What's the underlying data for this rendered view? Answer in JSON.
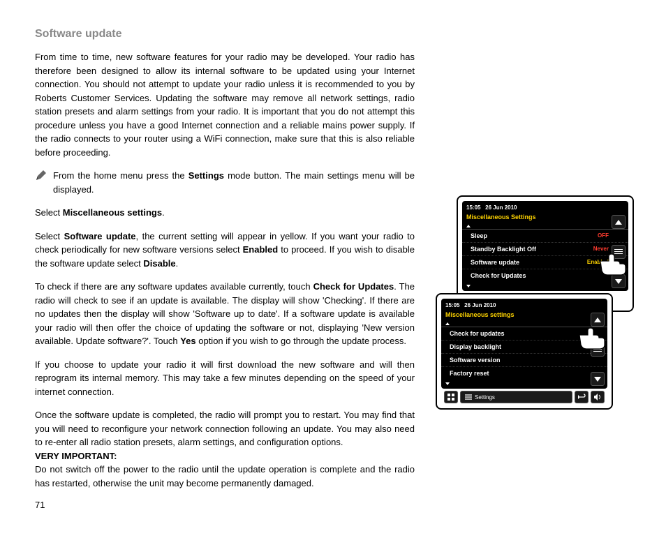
{
  "page_number": "71",
  "heading": "Software update",
  "intro": "From time to time, new software features for your radio may be developed. Your radio has therefore been designed to allow its internal software to be updated using your Internet connection. You should not attempt to update your radio unless it is recommended to you by Roberts Customer Services. Updating the software may remove all network settings, radio station presets and alarm settings from your radio. It is important that you do not attempt this procedure unless you have a good Internet connection and a reliable mains power supply. If the radio connects to your router using a WiFi connection, make sure that this is also reliable before proceeding.",
  "step_pen_prefix": "From the home menu press the ",
  "step_pen_bold": "Settings",
  "step_pen_suffix": " mode button. The main settings menu will be displayed.",
  "select_misc_prefix": "Select ",
  "select_misc_bold": "Miscellaneous settings",
  "select_misc_suffix": ".",
  "select_sw_prefix": "Select ",
  "select_sw_bold": "Software update",
  "select_sw_mid": ", the current setting will appear in yellow. If you want your radio to check periodically for new software versions select ",
  "select_sw_bold2": "Enabled",
  "select_sw_mid2": " to proceed. If you wish to disable the software update select ",
  "select_sw_bold3": "Disable",
  "select_sw_suffix": ".",
  "check_p_prefix": "To check if there are any software updates available currently, touch ",
  "check_p_bold": "Check for Updates",
  "check_p_mid": ". The radio will check to see if an update is available. The display will show 'Checking'. If there are no updates then the display will show 'Software up to date'. If a software update is available your radio will then offer the choice of updating the software or not, displaying 'New version available. Update software?'. Touch ",
  "check_p_bold2": "Yes",
  "check_p_suffix": " option if you wish to go through the update process.",
  "download_p": "If you choose to update your radio it will first download the new software and will then reprogram its internal memory. This may take a few minutes depending on the speed of your internet connection.",
  "restart_p": "Once the software update is completed, the radio will prompt you to restart. You may find that you will need to reconfigure your network connection following an update. You may also need to re-enter all radio station presets, alarm settings, and configuration options.",
  "vimp_label": "VERY IMPORTANT:",
  "vimp_text": "Do not switch off the power to the radio until the update operation is complete and the radio has restarted, otherwise the unit may become permanently damaged.",
  "device1": {
    "time": "15:05",
    "date": "26 Jun 2010",
    "title": "Miscellaneous Settings",
    "rows": [
      {
        "label": "Sleep",
        "value": "OFF",
        "cls": ""
      },
      {
        "label": "Standby Backlight Off",
        "value": "Never",
        "cls": ""
      },
      {
        "label": "Software update",
        "value": "Enabled",
        "cls": "enabled"
      },
      {
        "label": "Check for Updates",
        "value": "",
        "cls": ""
      }
    ]
  },
  "device2": {
    "time": "15:05",
    "date": "26 Jun 2010",
    "title": "Miscellaneous settings",
    "rows": [
      {
        "label": "Check for updates"
      },
      {
        "label": "Display backlight"
      },
      {
        "label": "Software version"
      },
      {
        "label": "Factory reset"
      }
    ],
    "bottom_label": "Settings"
  }
}
